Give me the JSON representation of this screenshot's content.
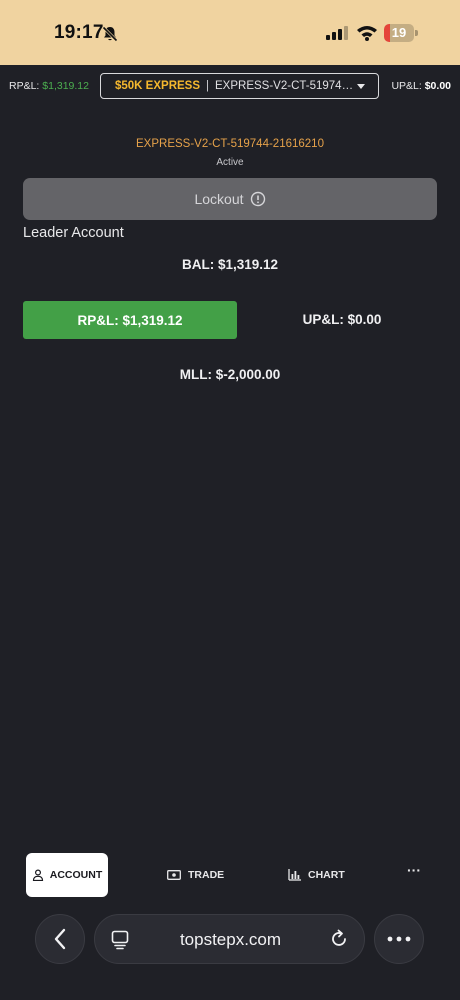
{
  "status_bar": {
    "time": "19:17",
    "battery_level": "19",
    "battery_percent": 19
  },
  "header": {
    "rpl_label": "RP&L: ",
    "rpl_value": "$1,319.12",
    "account_plan": "$50K EXPRESS",
    "account_separator": "|",
    "account_id_short": "EXPRESS-V2-CT-519744-21...",
    "upl_label": "UP&L: ",
    "upl_value": "$0.00"
  },
  "account": {
    "name": "EXPRESS-V2-CT-519744-21616210",
    "status": "Active",
    "lockout_label": "Lockout",
    "leader_label": "Leader Account",
    "balance": "BAL: $1,319.12",
    "rpl_button": "RP&L: $1,319.12",
    "upl": "UP&L: $0.00",
    "mll": "MLL: $-2,000.00"
  },
  "bottom_nav": {
    "account": "ACCOUNT",
    "trade": "TRADE",
    "chart": "CHART",
    "more": "···"
  },
  "browser": {
    "url": "topstepx.com"
  },
  "colors": {
    "background": "#1f2026",
    "status_bar": "#f0d3a0",
    "accent_green": "#43a047",
    "plan_yellow": "#f5b82e",
    "account_orange": "#e6a24a",
    "lockout_gray": "#646468",
    "battery_red": "#e5443a"
  }
}
